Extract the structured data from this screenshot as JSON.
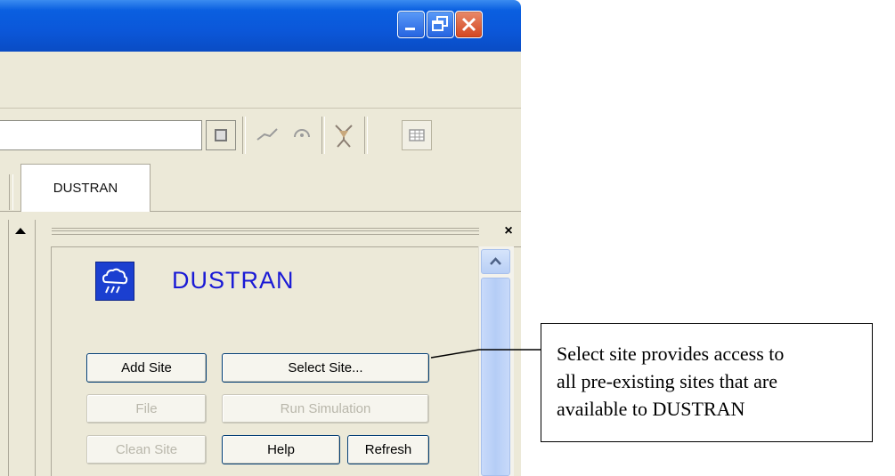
{
  "window": {
    "controls": {
      "minimize": "minimize",
      "restore": "restore",
      "close": "close"
    }
  },
  "tab": {
    "label": "DUSTRAN"
  },
  "panel": {
    "app_title": "DUSTRAN",
    "buttons": {
      "add_site": "Add Site",
      "select_site": "Select Site...",
      "file": "File",
      "run_simulation": "Run Simulation",
      "clean_site": "Clean Site",
      "help": "Help",
      "refresh": "Refresh"
    },
    "disabled": [
      "File",
      "Run Simulation",
      "Clean Site"
    ]
  },
  "callout": {
    "lines": [
      "Select site provides access to",
      "all pre-existing sites that are",
      "available to DUSTRAN"
    ]
  },
  "icons": [
    "minimize-icon",
    "restore-icon",
    "close-icon",
    "layer-square-icon",
    "line-tool-icon",
    "circle-tool-icon",
    "wind-figure-icon",
    "table-icon",
    "scroll-up-arrow-icon",
    "pane-close-icon",
    "weather-cloud-icon"
  ],
  "colors": {
    "title_bar": "#0b57d9",
    "app_title": "#1a1ad6",
    "face": "#ece9d8",
    "close_button": "#d4461f"
  }
}
